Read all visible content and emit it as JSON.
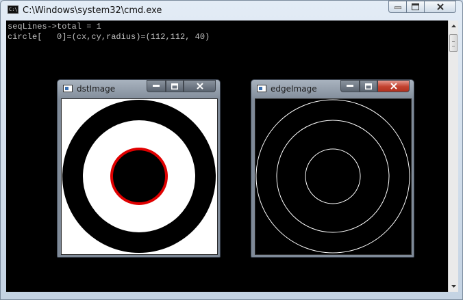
{
  "console_window": {
    "title": "C:\\Windows\\system32\\cmd.exe",
    "icon": "cmd-icon",
    "icon_text": "C:\\",
    "buttons": [
      "minimize-icon",
      "maximize-icon",
      "close-icon"
    ]
  },
  "console": {
    "lines": [
      "seqLines->total = 1",
      "circle[   0]=(cx,cy,radius)=(112,112, 40)"
    ],
    "background": "#000000",
    "text_color": "#c0c0c0"
  },
  "dst_window": {
    "title": "dstImage",
    "image": {
      "background": "#ffffff",
      "outer_ring_color": "#000000",
      "inner_disc_color": "#000000",
      "detected_circle_color": "#e00000"
    }
  },
  "edge_window": {
    "title": "edgeImage",
    "image": {
      "background": "#000000",
      "edge_color": "#ffffff"
    }
  }
}
